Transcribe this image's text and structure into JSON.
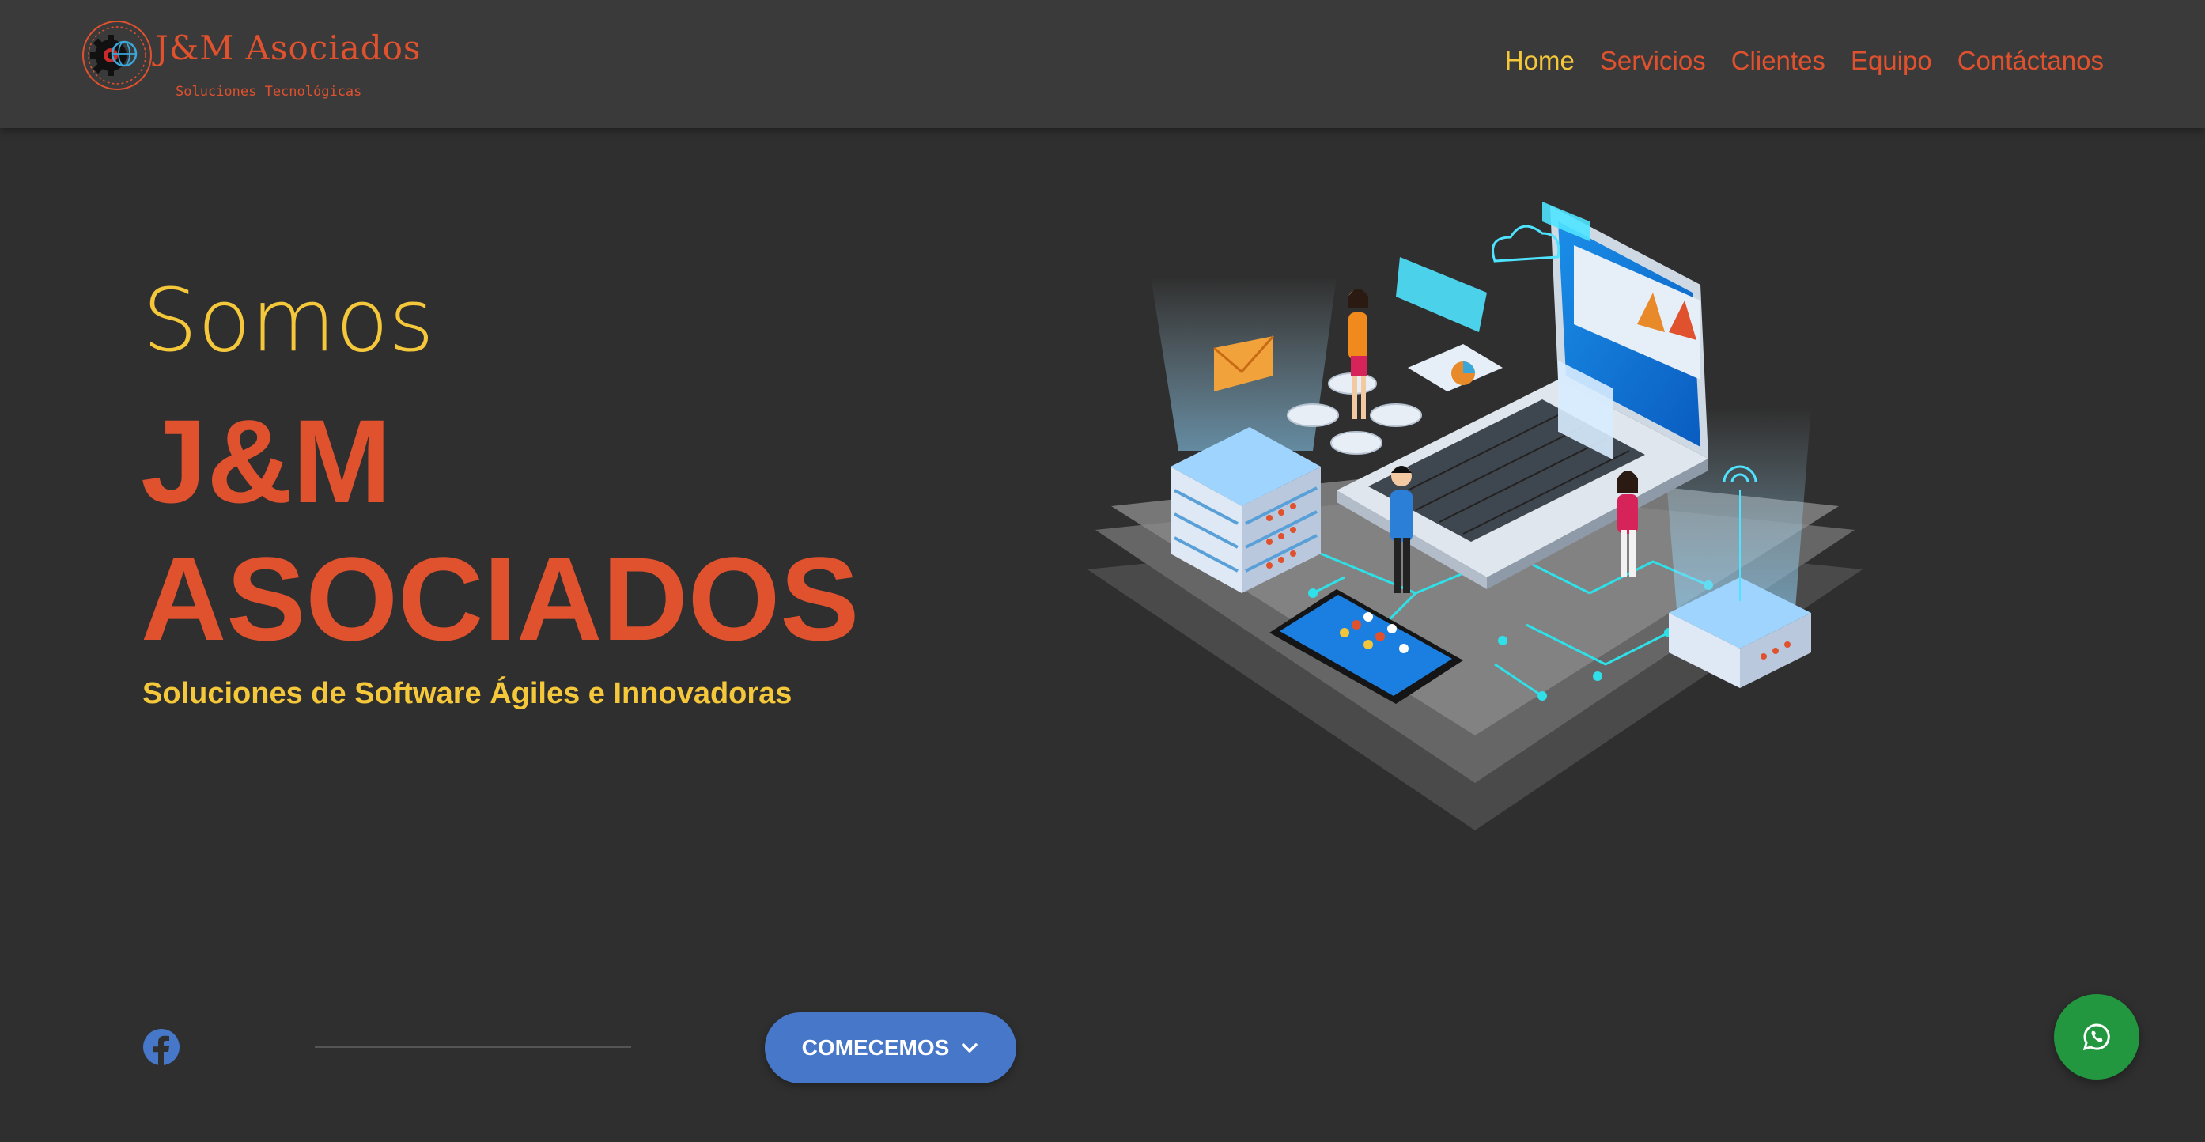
{
  "header": {
    "brand_name": "J&M Asociados",
    "brand_tagline": "Soluciones Tecnológicas",
    "nav": [
      {
        "label": "Home",
        "active": true
      },
      {
        "label": "Servicios",
        "active": false
      },
      {
        "label": "Clientes",
        "active": false
      },
      {
        "label": "Equipo",
        "active": false
      },
      {
        "label": "Contáctanos",
        "active": false
      }
    ]
  },
  "hero": {
    "line1": "Somos",
    "line2": "J&M",
    "line3": "ASOCIADOS",
    "subtitle": "Soluciones de Software Ágiles e Innovadoras",
    "cta_label": "COMECEMOS",
    "illustration": "isometric-tech-illustration"
  },
  "footer": {
    "social_icon": "facebook-icon",
    "chat_icon": "whatsapp-icon"
  },
  "colors": {
    "background": "#2f2f2f",
    "header": "#3a3a3a",
    "accent_orange": "#e0512e",
    "accent_yellow": "#f5c73a",
    "button_blue": "#4677c8",
    "whatsapp_green": "#22973f"
  }
}
